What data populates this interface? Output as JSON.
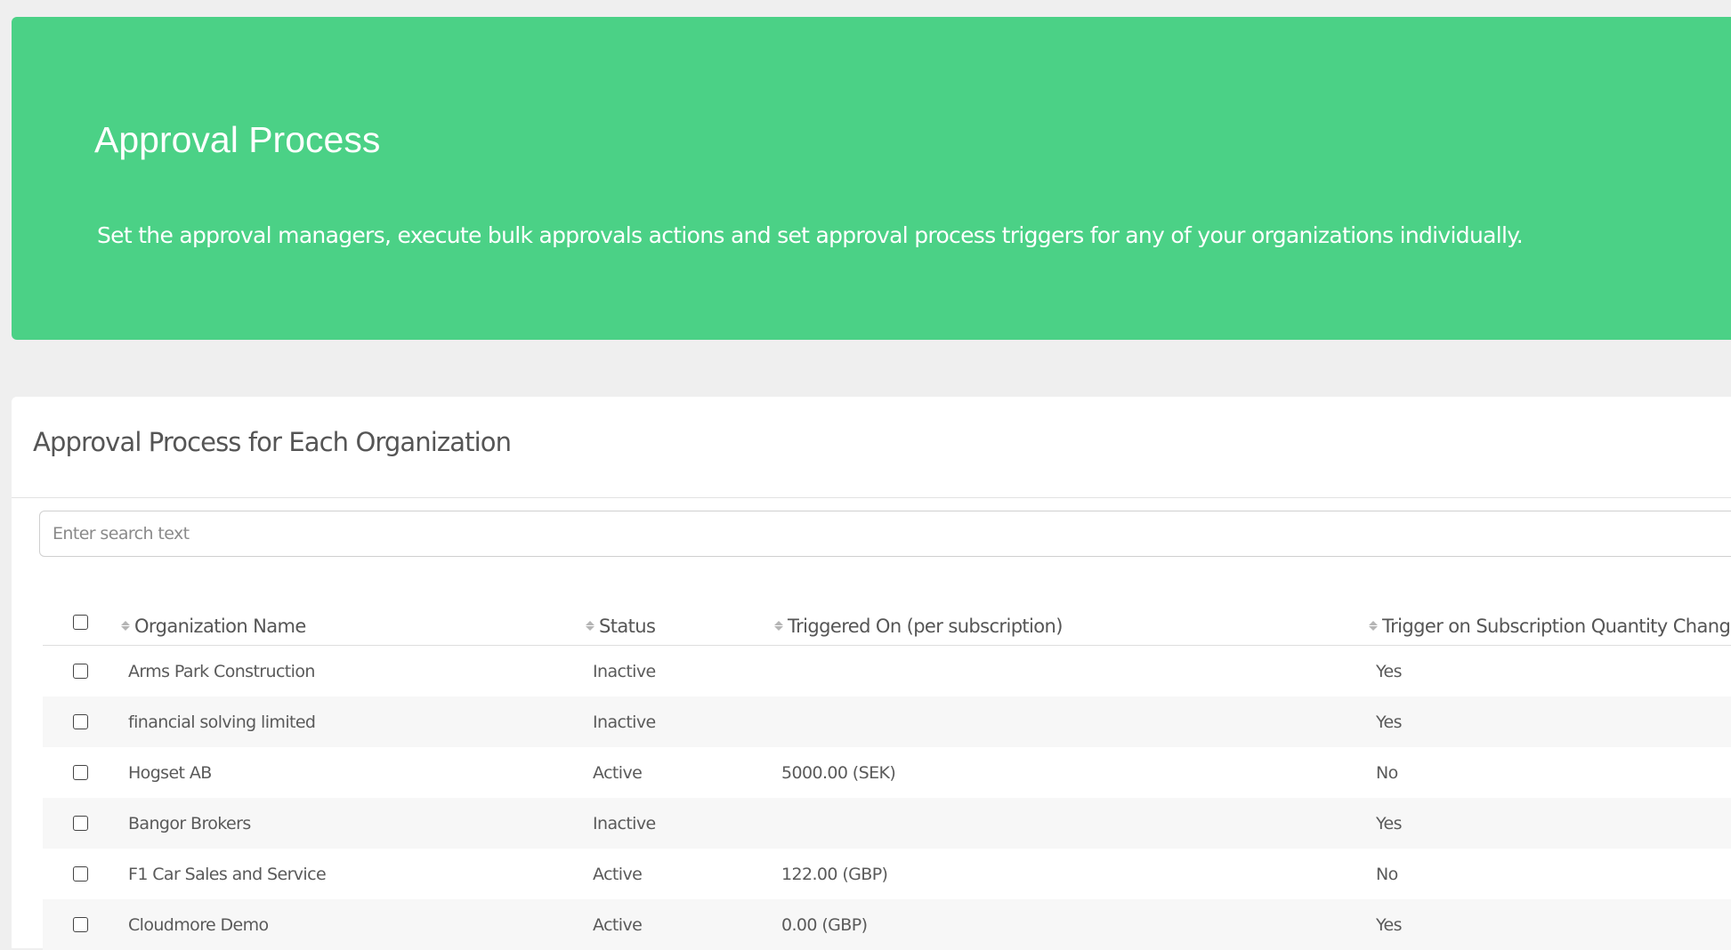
{
  "banner": {
    "title": "Approval Process",
    "description": "Set the approval managers, execute bulk approvals actions and set approval process triggers for any of your organizations individually.",
    "color": "#4bd186"
  },
  "panel": {
    "title": "Approval Process for Each Organization",
    "search_placeholder": "Enter search text"
  },
  "table": {
    "columns": [
      {
        "label": "Organization Name",
        "icon": "sort-icon"
      },
      {
        "label": "Status",
        "icon": "sort-icon"
      },
      {
        "label": "Triggered On (per subscription)",
        "icon": "sort-icon"
      },
      {
        "label": "Trigger on Subscription Quantity Changes",
        "icon": "sort-icon"
      }
    ],
    "rows": [
      {
        "organization": "Arms Park Construction",
        "status": "Inactive",
        "triggered_on": "",
        "quantity_changes": "Yes"
      },
      {
        "organization": "financial solving limited",
        "status": "Inactive",
        "triggered_on": "",
        "quantity_changes": "Yes"
      },
      {
        "organization": "Hogset AB",
        "status": "Active",
        "triggered_on": "5000.00 (SEK)",
        "quantity_changes": "No"
      },
      {
        "organization": "Bangor Brokers",
        "status": "Inactive",
        "triggered_on": "",
        "quantity_changes": "Yes"
      },
      {
        "organization": "F1 Car Sales and Service",
        "status": "Active",
        "triggered_on": "122.00 (GBP)",
        "quantity_changes": "No"
      },
      {
        "organization": "Cloudmore Demo",
        "status": "Active",
        "triggered_on": "0.00 (GBP)",
        "quantity_changes": "Yes"
      }
    ]
  }
}
